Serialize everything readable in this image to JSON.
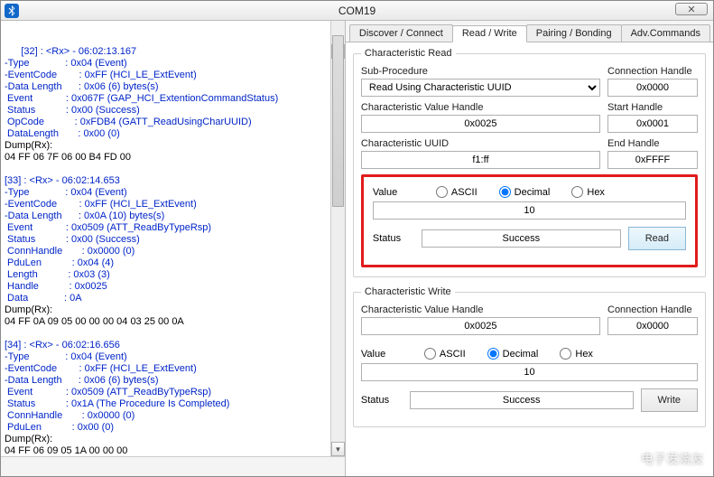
{
  "window": {
    "title": "COM19",
    "close_glyph": "✕"
  },
  "log": {
    "entries": [
      {
        "header": "[32] : <Rx> - 06:02:13.167",
        "rows": [
          {
            "k": "-Type",
            "v": ": 0x04 (Event)"
          },
          {
            "k": "-EventCode",
            "v": ": 0xFF (HCI_LE_ExtEvent)"
          },
          {
            "k": "-Data Length",
            "v": ": 0x06 (6) bytes(s)"
          },
          {
            "k": " Event",
            "v": ": 0x067F (GAP_HCI_ExtentionCommandStatus)"
          },
          {
            "k": " Status",
            "v": ": 0x00 (Success)"
          },
          {
            "k": " OpCode",
            "v": ": 0xFDB4 (GATT_ReadUsingCharUUID)"
          },
          {
            "k": " DataLength",
            "v": ": 0x00 (0)"
          }
        ],
        "dump_label": "Dump(Rx):",
        "dump": "04 FF 06 7F 06 00 B4 FD 00"
      },
      {
        "header": "[33] : <Rx> - 06:02:14.653",
        "rows": [
          {
            "k": "-Type",
            "v": ": 0x04 (Event)"
          },
          {
            "k": "-EventCode",
            "v": ": 0xFF (HCI_LE_ExtEvent)"
          },
          {
            "k": "-Data Length",
            "v": ": 0x0A (10) bytes(s)"
          },
          {
            "k": " Event",
            "v": ": 0x0509 (ATT_ReadByTypeRsp)"
          },
          {
            "k": " Status",
            "v": ": 0x00 (Success)"
          },
          {
            "k": " ConnHandle",
            "v": ": 0x0000 (0)"
          },
          {
            "k": " PduLen",
            "v": ": 0x04 (4)"
          },
          {
            "k": " Length",
            "v": ": 0x03 (3)"
          },
          {
            "k": " Handle",
            "v": ": 0x0025"
          },
          {
            "k": " Data",
            "v": ": 0A"
          }
        ],
        "dump_label": "Dump(Rx):",
        "dump": "04 FF 0A 09 05 00 00 00 04 03 25 00 0A"
      },
      {
        "header": "[34] : <Rx> - 06:02:16.656",
        "rows": [
          {
            "k": "-Type",
            "v": ": 0x04 (Event)"
          },
          {
            "k": "-EventCode",
            "v": ": 0xFF (HCI_LE_ExtEvent)"
          },
          {
            "k": "-Data Length",
            "v": ": 0x06 (6) bytes(s)"
          },
          {
            "k": " Event",
            "v": ": 0x0509 (ATT_ReadByTypeRsp)"
          },
          {
            "k": " Status",
            "v": ": 0x1A (The Procedure Is Completed)"
          },
          {
            "k": " ConnHandle",
            "v": ": 0x0000 (0)"
          },
          {
            "k": " PduLen",
            "v": ": 0x00 (0)"
          }
        ],
        "dump_label": "Dump(Rx):",
        "dump": "04 FF 06 09 05 1A 00 00 00"
      }
    ]
  },
  "tabs": {
    "items": [
      {
        "label": "Discover / Connect"
      },
      {
        "label": "Read / Write"
      },
      {
        "label": "Pairing / Bonding"
      },
      {
        "label": "Adv.Commands"
      }
    ],
    "active_index": 1
  },
  "read": {
    "legend": "Characteristic Read",
    "sub_procedure": {
      "label": "Sub-Procedure",
      "value": "Read Using Characteristic UUID"
    },
    "conn_handle": {
      "label": "Connection Handle",
      "value": "0x0000"
    },
    "char_value_handle": {
      "label": "Characteristic Value Handle",
      "value": "0x0025"
    },
    "start_handle": {
      "label": "Start Handle",
      "value": "0x0001"
    },
    "char_uuid": {
      "label": "Characteristic UUID",
      "value": "f1:ff"
    },
    "end_handle": {
      "label": "End Handle",
      "value": "0xFFFF"
    },
    "value_label": "Value",
    "ascii_label": "ASCII",
    "decimal_label": "Decimal",
    "hex_label": "Hex",
    "value": "10",
    "status_label": "Status",
    "status": "Success",
    "button": "Read"
  },
  "write": {
    "legend": "Characteristic Write",
    "char_value_handle": {
      "label": "Characteristic Value Handle",
      "value": "0x0025"
    },
    "conn_handle": {
      "label": "Connection Handle",
      "value": "0x0000"
    },
    "value_label": "Value",
    "ascii_label": "ASCII",
    "decimal_label": "Decimal",
    "hex_label": "Hex",
    "value": "10",
    "status_label": "Status",
    "status": "Success",
    "button": "Write"
  },
  "watermark": "电子发烧友"
}
